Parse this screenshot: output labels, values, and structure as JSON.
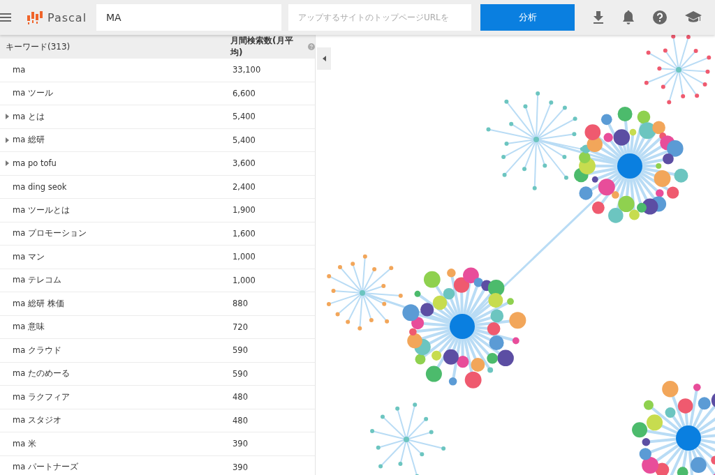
{
  "header": {
    "logo": "Pascal",
    "keyword_value": "MA",
    "url_placeholder": "アップするサイトのトップページURLを",
    "analyze_button": "分析"
  },
  "table": {
    "columns": [
      "キーワード(313)",
      "月間検索数(月平均)"
    ],
    "rows": [
      {
        "keyword": "ma",
        "volume": "33,100",
        "expandable": false
      },
      {
        "keyword": "ma ツール",
        "volume": "6,600",
        "expandable": false
      },
      {
        "keyword": "ma とは",
        "volume": "5,400",
        "expandable": true
      },
      {
        "keyword": "ma 総研",
        "volume": "5,400",
        "expandable": true
      },
      {
        "keyword": "ma po tofu",
        "volume": "3,600",
        "expandable": true
      },
      {
        "keyword": "ma ding seok",
        "volume": "2,400",
        "expandable": false
      },
      {
        "keyword": "ma ツールとは",
        "volume": "1,900",
        "expandable": false
      },
      {
        "keyword": "ma プロモーション",
        "volume": "1,600",
        "expandable": false
      },
      {
        "keyword": "ma マン",
        "volume": "1,000",
        "expandable": false
      },
      {
        "keyword": "ma テレコム",
        "volume": "1,000",
        "expandable": false
      },
      {
        "keyword": "ma 総研 株価",
        "volume": "880",
        "expandable": false
      },
      {
        "keyword": "ma 意味",
        "volume": "720",
        "expandable": false
      },
      {
        "keyword": "ma クラウド",
        "volume": "590",
        "expandable": false
      },
      {
        "keyword": "ma たのめーる",
        "volume": "590",
        "expandable": false
      },
      {
        "keyword": "ma ラクフィア",
        "volume": "480",
        "expandable": false
      },
      {
        "keyword": "ma スタジオ",
        "volume": "480",
        "expandable": false
      },
      {
        "keyword": "ma 米",
        "volume": "390",
        "expandable": false
      },
      {
        "keyword": "ma パートナーズ",
        "volume": "390",
        "expandable": false
      }
    ]
  }
}
